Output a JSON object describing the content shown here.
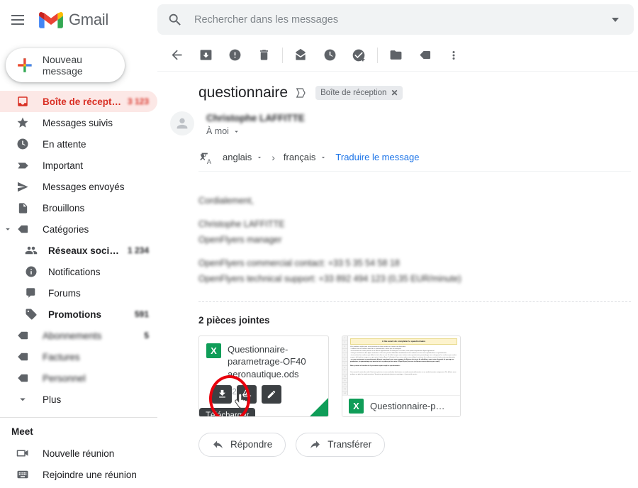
{
  "app": {
    "brand": "Gmail",
    "menu_icon": "hamburger-icon"
  },
  "search": {
    "placeholder": "Rechercher dans les messages",
    "value": "",
    "icon": "search-icon",
    "options_icon": "chevron-down-icon"
  },
  "sidebar": {
    "compose": {
      "label": "Nouveau message",
      "icon": "plus-icon"
    },
    "items": [
      {
        "label": "Boîte de récepti...",
        "icon": "inbox-icon",
        "count": "3 123",
        "active": true,
        "blurred_count": true
      },
      {
        "label": "Messages suivis",
        "icon": "star-icon",
        "count": ""
      },
      {
        "label": "En attente",
        "icon": "clock-icon",
        "count": ""
      },
      {
        "label": "Important",
        "icon": "important-icon",
        "count": ""
      },
      {
        "label": "Messages envoyés",
        "icon": "send-icon",
        "count": ""
      },
      {
        "label": "Brouillons",
        "icon": "draft-icon",
        "count": ""
      },
      {
        "label": "Catégories",
        "icon": "label-icon",
        "count": "",
        "expander": true
      }
    ],
    "categories": [
      {
        "label": "Réseaux socia...",
        "icon": "people-icon",
        "count": "1 234",
        "bold": true,
        "blurred_count": true
      },
      {
        "label": "Notifications",
        "icon": "info-icon",
        "count": ""
      },
      {
        "label": "Forums",
        "icon": "forum-icon",
        "count": ""
      },
      {
        "label": "Promotions",
        "icon": "tag-icon",
        "count": "591",
        "bold": true,
        "blurred_count": true
      }
    ],
    "labels": [
      {
        "label": "Abonnements",
        "icon": "label-icon",
        "count": "5",
        "blurred": true
      },
      {
        "label": "Factures",
        "icon": "label-icon",
        "count": "",
        "blurred": true
      },
      {
        "label": "Personnel",
        "icon": "label-icon",
        "count": "",
        "blurred": true
      }
    ],
    "more": {
      "label": "Plus",
      "icon": "chevron-down-icon"
    },
    "meet": {
      "title": "Meet",
      "items": [
        {
          "label": "Nouvelle réunion",
          "icon": "video-camera-icon"
        },
        {
          "label": "Rejoindre une réunion",
          "icon": "keyboard-icon"
        }
      ]
    }
  },
  "toolbar": {
    "items": [
      {
        "name": "back-button",
        "icon": "arrow-left-icon"
      },
      {
        "name": "archive-button",
        "icon": "archive-icon"
      },
      {
        "name": "report-spam-button",
        "icon": "report-spam-icon"
      },
      {
        "name": "delete-button",
        "icon": "trash-icon"
      },
      {
        "name": "mark-unread-button",
        "icon": "mark-unread-icon"
      },
      {
        "name": "snooze-button",
        "icon": "clock-icon"
      },
      {
        "name": "add-to-tasks-button",
        "icon": "add-task-icon"
      },
      {
        "name": "move-to-button",
        "icon": "folder-move-icon"
      },
      {
        "name": "labels-button",
        "icon": "tag-icon"
      },
      {
        "name": "more-options-button",
        "icon": "more-vertical-icon"
      }
    ]
  },
  "email": {
    "subject": "questionnaire",
    "chip_label": "Boîte de réception",
    "chip_close": "✕",
    "sender": "Christophe LAFFITTE",
    "recipient": "À moi",
    "translate": {
      "source_lang": "anglais",
      "target_lang": "français",
      "arrow": "›",
      "action": "Traduire le message",
      "icon": "translate-icon"
    },
    "body": [
      "Cordialement,",
      "Christophe LAFFITTE",
      "OpenFlyers manager",
      "OpenFlyers commercial contact: +33 5 35 54 58 18",
      "OpenFlyers technical support: +33 892 494 123 (0,35 EUR/minute)"
    ]
  },
  "attachments": {
    "title": "2 pièces jointes",
    "items": [
      {
        "filename": "Questionnaire-parametrage-OF40 aeronautique.ods",
        "size": "32 KB",
        "type_badge": "X",
        "actions": [
          {
            "name": "download-button",
            "icon": "download-icon",
            "tooltip": "Télécharger"
          },
          {
            "name": "add-to-drive-button",
            "icon": "add-to-drive-icon"
          },
          {
            "name": "edit-button",
            "icon": "pencil-icon"
          }
        ]
      },
      {
        "filename": "Questionnaire-para...",
        "type_badge": "X",
        "preview": {
          "banner": "A lire avant de compléter le questionnaire",
          "lines": [
            "Voici quelques règles pour vous permettre de bien prendre en compte vos demandes",
            "- n'effacez rien du contenu initial de ce questionnaire, même pas les exemples",
            "- écrivez dans les cases prévues à cet effet en apparaissant sur fond gris. Par contre, vous pouvez rajouter des lignes également",
            "- tenir gris en dessous des lignes existantes. Cela nous permet d'identifier immédiatement les endroits où vous avez répondu dans ce questionnaire",
            "- écrivez dans les couleurs par défaut c'est à dire en noir. En effet, lorsque nous traitons votre questionnaire paramétrage nous changeons les couleurs pour mettre ce qui a été traité en rouge ou ce qui reste à traiter. Aussi, l'utilisation d'une autre couleur nous oblige à reclasser les couleurs avant de traiter votre questionnaire",
            "- en nous retournant ce questionnaire dûment renseigné vous vous engagez à effectuer des tests de validation, avant votre demande de passage en production, du paramétrage qui aura été mis en place par les soins d'OpenFlyers (les tests à effectuer seront décrits par e-mail)",
            "Nom, prénom et fonction de la personne ayant rempli ce questionnaire :",
            "Concernant la saisie des vols il faut nous préciser si vous souhaitez fonctionner en mode ouverture/fermeture ou en mode fermeture uniquement. Par défaut, nous mettons en place le mode ouverture / fermeture qui présente plusieurs avantages : il permet de savoir..."
          ]
        }
      }
    ]
  },
  "actions": {
    "reply": {
      "label": "Répondre",
      "icon": "reply-icon"
    },
    "forward": {
      "label": "Transférer",
      "icon": "forward-icon"
    }
  },
  "colors": {
    "accent_red": "#d93025",
    "inbox_highlight": "#fce8e6",
    "link_blue": "#1a73e8",
    "sheet_green": "#0f9d58",
    "annotation_red": "#e8000d",
    "tooltip_bg": "#3c4043"
  }
}
